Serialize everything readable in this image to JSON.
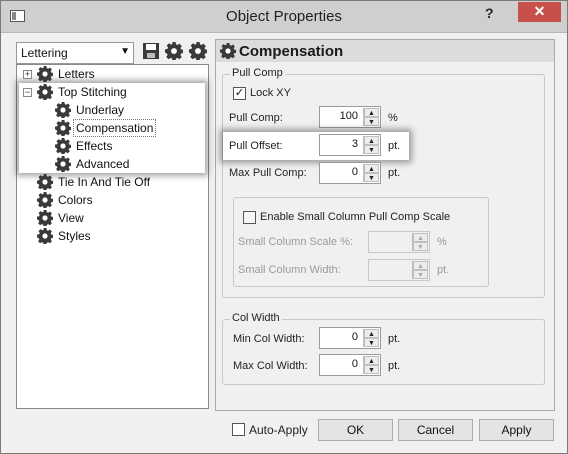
{
  "window": {
    "title": "Object Properties",
    "help": "?",
    "close": "✕"
  },
  "left": {
    "combo_value": "Lettering",
    "tree": [
      {
        "label": "Letters",
        "level": 0,
        "expander": "+"
      },
      {
        "label": "Top Stitching",
        "level": 0,
        "expander": "−"
      },
      {
        "label": "Underlay",
        "level": 1
      },
      {
        "label": "Compensation",
        "level": 1,
        "selected": true
      },
      {
        "label": "Effects",
        "level": 1
      },
      {
        "label": "Advanced",
        "level": 1
      },
      {
        "label": "Tie In And Tie Off",
        "level": 0
      },
      {
        "label": "Colors",
        "level": 0
      },
      {
        "label": "View",
        "level": 0
      },
      {
        "label": "Styles",
        "level": 0
      }
    ]
  },
  "panel": {
    "title": "Compensation",
    "pull_comp_group": "Pull Comp",
    "lock_xy": "Lock XY",
    "pull_comp_label": "Pull Comp:",
    "pull_comp_value": "100",
    "pull_comp_unit": "%",
    "pull_offset_label": "Pull Offset:",
    "pull_offset_value": "3",
    "pull_offset_unit": "pt.",
    "max_pull_label": "Max Pull Comp:",
    "max_pull_value": "0",
    "max_pull_unit": "pt.",
    "enable_small": "Enable Small Column Pull Comp Scale",
    "small_scale_label": "Small Column Scale %:",
    "small_scale_unit": "%",
    "small_width_label": "Small Column Width:",
    "small_width_unit": "pt.",
    "col_width_group": "Col Width",
    "min_col_label": "Min Col Width:",
    "min_col_value": "0",
    "min_col_unit": "pt.",
    "max_col_label": "Max Col Width:",
    "max_col_value": "0",
    "max_col_unit": "pt."
  },
  "footer": {
    "auto_apply": "Auto-Apply",
    "ok": "OK",
    "cancel": "Cancel",
    "apply": "Apply"
  }
}
